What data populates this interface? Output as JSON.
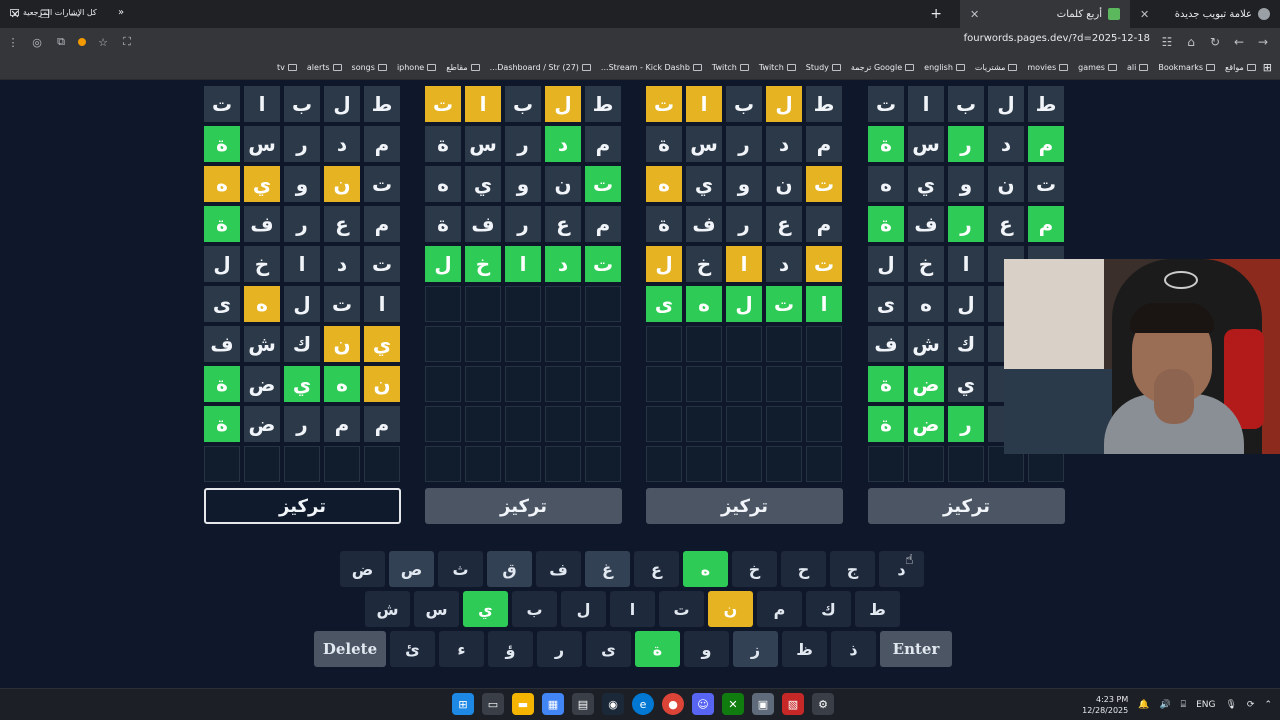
{
  "browser": {
    "tabs": [
      {
        "title": "أربع كلمات",
        "active": true
      },
      {
        "title": "علامة تبويب جديدة",
        "active": false
      }
    ],
    "url": "fourwords.pages.dev/?d=2025-12-18",
    "bookmarks": [
      "Bookmarks",
      "ali",
      "games",
      "movies",
      "مشتريات",
      "english",
      "Google ترجمة",
      "Study",
      "Twitch",
      "Twitch",
      "Stream - Kick Dashb...",
      "(27) Dashboard / Str...",
      "مقاطع",
      "iphone",
      "songs",
      "alerts",
      "tv"
    ],
    "bookmarks_right": "مواقع",
    "all_bookmarks": "كل الإشارات المرجعية"
  },
  "boards": [
    {
      "focus_label": "تركيز",
      "active": true,
      "rows": [
        [
          {
            "l": "ط",
            "s": ""
          },
          {
            "l": "ل",
            "s": ""
          },
          {
            "l": "ب",
            "s": ""
          },
          {
            "l": "ا",
            "s": ""
          },
          {
            "l": "ت",
            "s": ""
          }
        ],
        [
          {
            "l": "م",
            "s": ""
          },
          {
            "l": "د",
            "s": ""
          },
          {
            "l": "ر",
            "s": ""
          },
          {
            "l": "س",
            "s": ""
          },
          {
            "l": "ة",
            "s": "g"
          }
        ],
        [
          {
            "l": "ت",
            "s": ""
          },
          {
            "l": "ن",
            "s": "y"
          },
          {
            "l": "و",
            "s": ""
          },
          {
            "l": "ي",
            "s": "y"
          },
          {
            "l": "ه",
            "s": "y"
          }
        ],
        [
          {
            "l": "م",
            "s": ""
          },
          {
            "l": "ع",
            "s": ""
          },
          {
            "l": "ر",
            "s": ""
          },
          {
            "l": "ف",
            "s": ""
          },
          {
            "l": "ة",
            "s": "g"
          }
        ],
        [
          {
            "l": "ت",
            "s": ""
          },
          {
            "l": "د",
            "s": ""
          },
          {
            "l": "ا",
            "s": ""
          },
          {
            "l": "خ",
            "s": ""
          },
          {
            "l": "ل",
            "s": ""
          }
        ],
        [
          {
            "l": "ا",
            "s": ""
          },
          {
            "l": "ت",
            "s": ""
          },
          {
            "l": "ل",
            "s": ""
          },
          {
            "l": "ه",
            "s": "y"
          },
          {
            "l": "ى",
            "s": ""
          }
        ],
        [
          {
            "l": "ي",
            "s": "y"
          },
          {
            "l": "ن",
            "s": "y"
          },
          {
            "l": "ك",
            "s": ""
          },
          {
            "l": "ش",
            "s": ""
          },
          {
            "l": "ف",
            "s": ""
          }
        ],
        [
          {
            "l": "ن",
            "s": "y"
          },
          {
            "l": "ه",
            "s": "g"
          },
          {
            "l": "ي",
            "s": "g"
          },
          {
            "l": "ض",
            "s": ""
          },
          {
            "l": "ة",
            "s": "g"
          }
        ],
        [
          {
            "l": "م",
            "s": ""
          },
          {
            "l": "م",
            "s": ""
          },
          {
            "l": "ر",
            "s": ""
          },
          {
            "l": "ض",
            "s": ""
          },
          {
            "l": "ة",
            "s": "g"
          }
        ],
        [
          {
            "l": "",
            "s": "e"
          },
          {
            "l": "",
            "s": "e"
          },
          {
            "l": "",
            "s": "e"
          },
          {
            "l": "",
            "s": "e"
          },
          {
            "l": "",
            "s": "e"
          }
        ]
      ]
    },
    {
      "focus_label": "تركيز",
      "active": false,
      "rows": [
        [
          {
            "l": "ط",
            "s": ""
          },
          {
            "l": "ل",
            "s": "y"
          },
          {
            "l": "ب",
            "s": ""
          },
          {
            "l": "ا",
            "s": "y"
          },
          {
            "l": "ت",
            "s": "y"
          }
        ],
        [
          {
            "l": "م",
            "s": ""
          },
          {
            "l": "د",
            "s": "g"
          },
          {
            "l": "ر",
            "s": ""
          },
          {
            "l": "س",
            "s": ""
          },
          {
            "l": "ة",
            "s": ""
          }
        ],
        [
          {
            "l": "ت",
            "s": "g"
          },
          {
            "l": "ن",
            "s": ""
          },
          {
            "l": "و",
            "s": ""
          },
          {
            "l": "ي",
            "s": ""
          },
          {
            "l": "ه",
            "s": ""
          }
        ],
        [
          {
            "l": "م",
            "s": ""
          },
          {
            "l": "ع",
            "s": ""
          },
          {
            "l": "ر",
            "s": ""
          },
          {
            "l": "ف",
            "s": ""
          },
          {
            "l": "ة",
            "s": ""
          }
        ],
        [
          {
            "l": "ت",
            "s": "g"
          },
          {
            "l": "د",
            "s": "g"
          },
          {
            "l": "ا",
            "s": "g"
          },
          {
            "l": "خ",
            "s": "g"
          },
          {
            "l": "ل",
            "s": "g"
          }
        ],
        [
          {
            "l": "",
            "s": "e"
          },
          {
            "l": "",
            "s": "e"
          },
          {
            "l": "",
            "s": "e"
          },
          {
            "l": "",
            "s": "e"
          },
          {
            "l": "",
            "s": "e"
          }
        ],
        [
          {
            "l": "",
            "s": "e"
          },
          {
            "l": "",
            "s": "e"
          },
          {
            "l": "",
            "s": "e"
          },
          {
            "l": "",
            "s": "e"
          },
          {
            "l": "",
            "s": "e"
          }
        ],
        [
          {
            "l": "",
            "s": "e"
          },
          {
            "l": "",
            "s": "e"
          },
          {
            "l": "",
            "s": "e"
          },
          {
            "l": "",
            "s": "e"
          },
          {
            "l": "",
            "s": "e"
          }
        ],
        [
          {
            "l": "",
            "s": "e"
          },
          {
            "l": "",
            "s": "e"
          },
          {
            "l": "",
            "s": "e"
          },
          {
            "l": "",
            "s": "e"
          },
          {
            "l": "",
            "s": "e"
          }
        ],
        [
          {
            "l": "",
            "s": "e"
          },
          {
            "l": "",
            "s": "e"
          },
          {
            "l": "",
            "s": "e"
          },
          {
            "l": "",
            "s": "e"
          },
          {
            "l": "",
            "s": "e"
          }
        ]
      ]
    },
    {
      "focus_label": "تركيز",
      "active": false,
      "rows": [
        [
          {
            "l": "ط",
            "s": ""
          },
          {
            "l": "ل",
            "s": "y"
          },
          {
            "l": "ب",
            "s": ""
          },
          {
            "l": "ا",
            "s": "y"
          },
          {
            "l": "ت",
            "s": "y"
          }
        ],
        [
          {
            "l": "م",
            "s": ""
          },
          {
            "l": "د",
            "s": ""
          },
          {
            "l": "ر",
            "s": ""
          },
          {
            "l": "س",
            "s": ""
          },
          {
            "l": "ة",
            "s": ""
          }
        ],
        [
          {
            "l": "ت",
            "s": "y"
          },
          {
            "l": "ن",
            "s": ""
          },
          {
            "l": "و",
            "s": ""
          },
          {
            "l": "ي",
            "s": ""
          },
          {
            "l": "ه",
            "s": "y"
          }
        ],
        [
          {
            "l": "م",
            "s": ""
          },
          {
            "l": "ع",
            "s": ""
          },
          {
            "l": "ر",
            "s": ""
          },
          {
            "l": "ف",
            "s": ""
          },
          {
            "l": "ة",
            "s": ""
          }
        ],
        [
          {
            "l": "ت",
            "s": "y"
          },
          {
            "l": "د",
            "s": ""
          },
          {
            "l": "ا",
            "s": "y"
          },
          {
            "l": "خ",
            "s": ""
          },
          {
            "l": "ل",
            "s": "y"
          }
        ],
        [
          {
            "l": "ا",
            "s": "g"
          },
          {
            "l": "ت",
            "s": "g"
          },
          {
            "l": "ل",
            "s": "g"
          },
          {
            "l": "ه",
            "s": "g"
          },
          {
            "l": "ى",
            "s": "g"
          }
        ],
        [
          {
            "l": "",
            "s": "e"
          },
          {
            "l": "",
            "s": "e"
          },
          {
            "l": "",
            "s": "e"
          },
          {
            "l": "",
            "s": "e"
          },
          {
            "l": "",
            "s": "e"
          }
        ],
        [
          {
            "l": "",
            "s": "e"
          },
          {
            "l": "",
            "s": "e"
          },
          {
            "l": "",
            "s": "e"
          },
          {
            "l": "",
            "s": "e"
          },
          {
            "l": "",
            "s": "e"
          }
        ],
        [
          {
            "l": "",
            "s": "e"
          },
          {
            "l": "",
            "s": "e"
          },
          {
            "l": "",
            "s": "e"
          },
          {
            "l": "",
            "s": "e"
          },
          {
            "l": "",
            "s": "e"
          }
        ],
        [
          {
            "l": "",
            "s": "e"
          },
          {
            "l": "",
            "s": "e"
          },
          {
            "l": "",
            "s": "e"
          },
          {
            "l": "",
            "s": "e"
          },
          {
            "l": "",
            "s": "e"
          }
        ]
      ]
    },
    {
      "focus_label": "تركيز",
      "active": false,
      "rows": [
        [
          {
            "l": "ط",
            "s": ""
          },
          {
            "l": "ل",
            "s": ""
          },
          {
            "l": "ب",
            "s": ""
          },
          {
            "l": "ا",
            "s": ""
          },
          {
            "l": "ت",
            "s": ""
          }
        ],
        [
          {
            "l": "م",
            "s": "g"
          },
          {
            "l": "د",
            "s": ""
          },
          {
            "l": "ر",
            "s": "g"
          },
          {
            "l": "س",
            "s": ""
          },
          {
            "l": "ة",
            "s": "g"
          }
        ],
        [
          {
            "l": "ت",
            "s": ""
          },
          {
            "l": "ن",
            "s": ""
          },
          {
            "l": "و",
            "s": ""
          },
          {
            "l": "ي",
            "s": ""
          },
          {
            "l": "ه",
            "s": ""
          }
        ],
        [
          {
            "l": "م",
            "s": "g"
          },
          {
            "l": "ع",
            "s": ""
          },
          {
            "l": "ر",
            "s": "g"
          },
          {
            "l": "ف",
            "s": ""
          },
          {
            "l": "ة",
            "s": "g"
          }
        ],
        [
          {
            "l": "",
            "s": ""
          },
          {
            "l": "",
            "s": ""
          },
          {
            "l": "ا",
            "s": ""
          },
          {
            "l": "خ",
            "s": ""
          },
          {
            "l": "ل",
            "s": ""
          }
        ],
        [
          {
            "l": "",
            "s": ""
          },
          {
            "l": "",
            "s": ""
          },
          {
            "l": "ل",
            "s": ""
          },
          {
            "l": "ه",
            "s": ""
          },
          {
            "l": "ى",
            "s": ""
          }
        ],
        [
          {
            "l": "",
            "s": ""
          },
          {
            "l": "",
            "s": ""
          },
          {
            "l": "ك",
            "s": ""
          },
          {
            "l": "ش",
            "s": ""
          },
          {
            "l": "ف",
            "s": ""
          }
        ],
        [
          {
            "l": "",
            "s": ""
          },
          {
            "l": "",
            "s": ""
          },
          {
            "l": "ي",
            "s": ""
          },
          {
            "l": "ض",
            "s": "g"
          },
          {
            "l": "ة",
            "s": "g"
          }
        ],
        [
          {
            "l": "",
            "s": ""
          },
          {
            "l": "",
            "s": ""
          },
          {
            "l": "ر",
            "s": "g"
          },
          {
            "l": "ض",
            "s": "g"
          },
          {
            "l": "ة",
            "s": "g"
          }
        ],
        [
          {
            "l": "",
            "s": "e"
          },
          {
            "l": "",
            "s": "e"
          },
          {
            "l": "",
            "s": "e"
          },
          {
            "l": "",
            "s": "e"
          },
          {
            "l": "",
            "s": "e"
          }
        ]
      ]
    }
  ],
  "keyboard": {
    "row1": [
      {
        "k": "د",
        "s": ""
      },
      {
        "k": "ج",
        "s": ""
      },
      {
        "k": "ح",
        "s": ""
      },
      {
        "k": "خ",
        "s": ""
      },
      {
        "k": "ه",
        "s": "g"
      },
      {
        "k": "ع",
        "s": ""
      },
      {
        "k": "غ",
        "s": "used"
      },
      {
        "k": "ف",
        "s": ""
      },
      {
        "k": "ق",
        "s": "used"
      },
      {
        "k": "ث",
        "s": ""
      },
      {
        "k": "ص",
        "s": "used"
      },
      {
        "k": "ض",
        "s": ""
      }
    ],
    "row2": [
      {
        "k": "ط",
        "s": ""
      },
      {
        "k": "ك",
        "s": ""
      },
      {
        "k": "م",
        "s": ""
      },
      {
        "k": "ن",
        "s": "y"
      },
      {
        "k": "ت",
        "s": ""
      },
      {
        "k": "ا",
        "s": ""
      },
      {
        "k": "ل",
        "s": ""
      },
      {
        "k": "ب",
        "s": ""
      },
      {
        "k": "ي",
        "s": "g"
      },
      {
        "k": "س",
        "s": ""
      },
      {
        "k": "ش",
        "s": ""
      }
    ],
    "row3_mid": [
      {
        "k": "ذ",
        "s": ""
      },
      {
        "k": "ظ",
        "s": ""
      },
      {
        "k": "ز",
        "s": "used"
      },
      {
        "k": "و",
        "s": ""
      },
      {
        "k": "ة",
        "s": "g"
      },
      {
        "k": "ى",
        "s": ""
      },
      {
        "k": "ر",
        "s": ""
      },
      {
        "k": "ؤ",
        "s": ""
      },
      {
        "k": "ء",
        "s": ""
      },
      {
        "k": "ئ",
        "s": ""
      }
    ],
    "enter_label": "Enter",
    "delete_label": "Delete"
  },
  "taskbar": {
    "lang": "ENG",
    "time": "4:23 PM",
    "date": "12/28/2025"
  },
  "colors": {
    "green": "#2ecc56",
    "yellow": "#e6b422",
    "tile": "#2c3949",
    "bg": "#0f172a"
  }
}
